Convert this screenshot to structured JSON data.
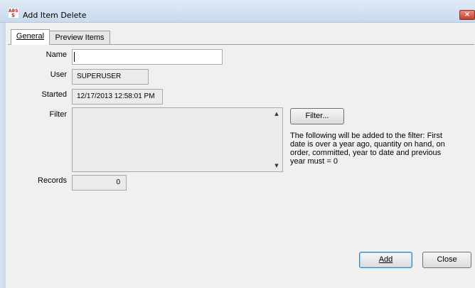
{
  "window": {
    "title": "Add Item Delete",
    "icon": "app-logo-icon",
    "close_glyph": "×"
  },
  "tabs": [
    {
      "label": "General",
      "active": true
    },
    {
      "label": "Preview Items",
      "active": false
    }
  ],
  "form": {
    "name_label": "Name",
    "name_value": "",
    "user_label": "User",
    "user_value": "SUPERUSER",
    "started_label": "Started",
    "started_value": "12/17/2013 12:58:01 PM",
    "filter_label": "Filter",
    "filter_value": "",
    "filter_button": "Filter...",
    "filter_note": "The following will be added to the filter: First date is over a year ago, quantity on hand, on order, committed, year to date and previous year must = 0",
    "records_label": "Records",
    "records_value": "0"
  },
  "buttons": {
    "add": "Add",
    "close": "Close"
  },
  "colors": {
    "titlebar": "#c9daee",
    "background": "#f0f0f0",
    "field_readonly": "#ebebeb"
  }
}
